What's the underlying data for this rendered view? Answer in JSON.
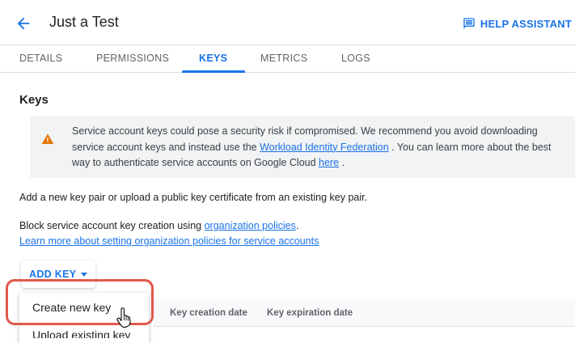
{
  "header": {
    "title": "Just a Test",
    "back_icon": "arrow-back-icon",
    "help_label": "HELP ASSISTANT",
    "help_icon": "chat-assistant-icon"
  },
  "tabs": [
    {
      "label": "DETAILS",
      "active": false
    },
    {
      "label": "PERMISSIONS",
      "active": false
    },
    {
      "label": "KEYS",
      "active": true
    },
    {
      "label": "METRICS",
      "active": false
    },
    {
      "label": "LOGS",
      "active": false
    }
  ],
  "keys": {
    "title": "Keys",
    "warning": {
      "icon": "warning-icon",
      "text_1": "Service account keys could pose a security risk if compromised. We recommend you avoid downloading service account keys and instead use the ",
      "link_1": "Workload Identity Federation",
      "text_2": " . You can learn more about the best way to authenticate service accounts on Google Cloud ",
      "link_2": "here",
      "text_3": " ."
    },
    "add_pair_text": "Add a new key pair or upload a public key certificate from an existing key pair.",
    "block_text": "Block service account key creation using ",
    "block_link": "organization policies",
    "block_end": ".",
    "learn_link": "Learn more about setting organization policies for service accounts",
    "add_key_label": "ADD KEY",
    "menu": {
      "create": "Create new key",
      "upload": "Upload existing key"
    },
    "table_headers": [
      "Key creation date",
      "Key expiration date"
    ]
  },
  "colors": {
    "accent": "#1a73e8",
    "warning": "#e37400",
    "highlight": "#e0584a"
  }
}
